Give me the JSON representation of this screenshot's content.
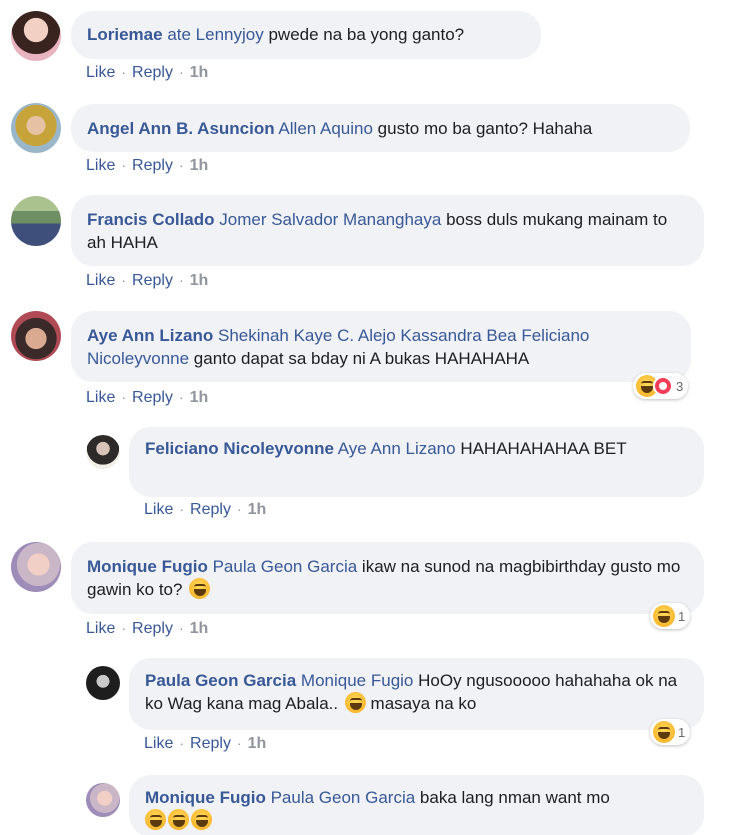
{
  "actions": {
    "like": "Like",
    "reply": "Reply",
    "sep": "·"
  },
  "comments": [
    {
      "author": "Loriemae",
      "mentions": "ate Lennyjoy",
      "text": " pwede na ba yong ganto?",
      "time": "1h"
    },
    {
      "author": "Angel Ann B. Asuncion",
      "mentions": "Allen Aquino",
      "text": " gusto mo ba ganto? Hahaha",
      "time": "1h"
    },
    {
      "author": "Francis Collado",
      "mentions": "Jomer Salvador Mananghaya",
      "text": " boss duls mukang mainam to ah HAHA",
      "time": "1h"
    },
    {
      "author": "Aye Ann Lizano",
      "mentions": "Shekinah Kaye C. Alejo Kassandra Bea Feliciano Nicoleyvonne",
      "text": " ganto dapat sa bday ni A bukas HAHAHAHA",
      "time": "1h",
      "reaction_count": "3"
    },
    {
      "author": "Feliciano Nicoleyvonne",
      "mentions": "Aye Ann Lizano",
      "text": " HAHAHAHAHAA BET",
      "time": "1h"
    },
    {
      "author": "Monique Fugio",
      "mentions": "Paula Geon Garcia",
      "text": " ikaw na sunod na magbibirthday gusto mo gawin ko to?",
      "time": "1h",
      "reaction_count": "1"
    },
    {
      "author": "Paula Geon Garcia",
      "mentions": "Monique Fugio",
      "text": " HoOy ngusooooo hahahaha ok na ko Wag kana mag Abala..",
      "text2": " masaya na ko",
      "time": "1h",
      "reaction_count": "1"
    },
    {
      "author": "Monique Fugio",
      "mentions": "Paula Geon Garcia",
      "text": " baka lang nman want mo"
    }
  ]
}
